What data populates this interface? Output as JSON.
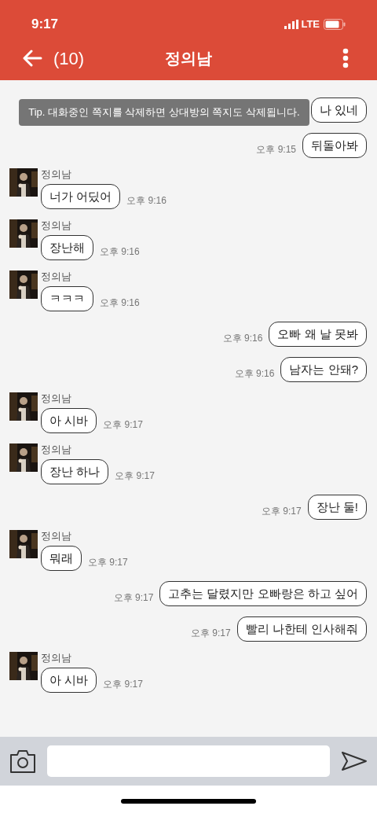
{
  "status_bar": {
    "time": "9:17",
    "network": "LTE"
  },
  "header": {
    "unread_count": "(10)",
    "title": "정의남"
  },
  "tip": "Tip. 대화중인 쪽지를 삭제하면 상대방의 쪽지도 삭제됩니다.",
  "messages": [
    {
      "kind": "out",
      "text": "나 있네"
    },
    {
      "kind": "out",
      "text": "뒤돌아봐",
      "time": "오후 9:15"
    },
    {
      "kind": "in",
      "sender": "정의남",
      "text": "너가 어딨어",
      "time": "오후 9:16"
    },
    {
      "kind": "in",
      "sender": "정의남",
      "text": "장난해",
      "time": "오후 9:16"
    },
    {
      "kind": "in",
      "sender": "정의남",
      "text": "ㅋㅋㅋ",
      "time": "오후 9:16"
    },
    {
      "kind": "out",
      "text": "오빠 왜 날 못봐",
      "time": "오후 9:16"
    },
    {
      "kind": "out",
      "text": "남자는 안돼?",
      "time": "오후 9:16"
    },
    {
      "kind": "in",
      "sender": "정의남",
      "text": "아 시바",
      "time": "오후 9:17"
    },
    {
      "kind": "in",
      "sender": "정의남",
      "text": "장난 하나",
      "time": "오후 9:17"
    },
    {
      "kind": "out",
      "text": "장난 둘!",
      "time": "오후 9:17"
    },
    {
      "kind": "in",
      "sender": "정의남",
      "text": "뭐래",
      "time": "오후 9:17"
    },
    {
      "kind": "out",
      "text": "고추는 달렸지만 오빠랑은 하고 싶어",
      "time": "오후 9:17"
    },
    {
      "kind": "out",
      "text": "빨리 나한테 인사해줘",
      "time": "오후 9:17"
    },
    {
      "kind": "in",
      "sender": "정의남",
      "text": "아 시바",
      "time": "오후 9:17"
    }
  ]
}
